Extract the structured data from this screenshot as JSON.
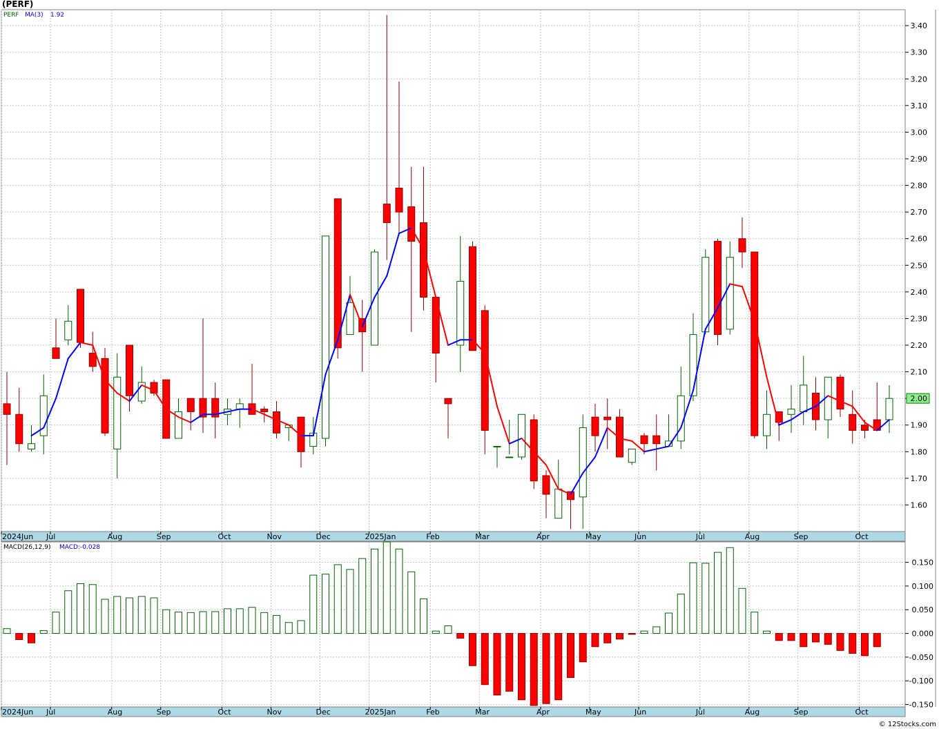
{
  "title": "(PERF)",
  "credit": "© 12Stocks.com",
  "colors": {
    "up": "#006400",
    "down": "#ff0000",
    "down_outline": "#8b0000",
    "ma": "#0000ff",
    "ma_down": "#ff0000",
    "grid": "#c0c0c0",
    "axis_band": "#add8e6",
    "last_price_box": "#90ee90"
  },
  "chart_data": [
    {
      "type": "candlestick",
      "legend": {
        "symbol": "PERF",
        "ma_label": "MA(3)",
        "ma_value": "1.92"
      },
      "last_price_label": "2.00",
      "y_ticks": [
        "1.60",
        "1.70",
        "1.80",
        "1.90",
        "2.00",
        "2.10",
        "2.20",
        "2.30",
        "2.40",
        "2.50",
        "2.60",
        "2.70",
        "2.80",
        "2.90",
        "3.00",
        "3.10",
        "3.20",
        "3.30",
        "3.40"
      ],
      "ylim": [
        1.5,
        3.46
      ],
      "x_labels": [
        "2024Jun",
        "Jul",
        "Aug",
        "Sep",
        "Oct",
        "Nov",
        "Dec",
        "2025Jan",
        "Feb",
        "Mar",
        "Apr",
        "May",
        "Jun",
        "Jul",
        "Aug",
        "Sep",
        "Oct"
      ],
      "x_label_weeks": [
        0,
        4,
        9,
        13,
        18,
        22,
        26,
        30,
        35,
        39,
        44,
        48,
        52,
        57,
        61,
        65,
        70
      ],
      "weeks": 72,
      "candles": [
        [
          1.98,
          2.1,
          1.75,
          1.94
        ],
        [
          1.94,
          2.04,
          1.8,
          1.83
        ],
        [
          1.81,
          1.9,
          1.8,
          1.83
        ],
        [
          1.86,
          2.09,
          1.79,
          2.01
        ],
        [
          2.19,
          2.3,
          2.15,
          2.15
        ],
        [
          2.22,
          2.35,
          2.2,
          2.29
        ],
        [
          2.41,
          2.38,
          2.19,
          2.21
        ],
        [
          2.17,
          2.25,
          2.1,
          2.12
        ],
        [
          2.15,
          2.19,
          1.86,
          1.87
        ],
        [
          1.81,
          2.17,
          1.7,
          2.08
        ],
        [
          2.2,
          2.1,
          1.95,
          2.01
        ],
        [
          1.99,
          2.12,
          1.98,
          2.06
        ],
        [
          2.06,
          2.07,
          2.01,
          2.02
        ],
        [
          2.07,
          2.0,
          1.85,
          1.85
        ],
        [
          1.85,
          2.0,
          1.85,
          1.95
        ],
        [
          2.0,
          2.0,
          1.88,
          1.95
        ],
        [
          2.0,
          2.3,
          1.87,
          1.93
        ],
        [
          2.0,
          2.06,
          1.85,
          1.93
        ],
        [
          1.94,
          2.0,
          1.9,
          1.96
        ],
        [
          1.96,
          2.0,
          1.89,
          1.98
        ],
        [
          1.98,
          2.13,
          1.95,
          1.94
        ],
        [
          1.96,
          1.97,
          1.91,
          1.95
        ],
        [
          1.95,
          1.99,
          1.85,
          1.87
        ],
        [
          1.89,
          1.89,
          1.84,
          1.9
        ],
        [
          1.93,
          1.93,
          1.74,
          1.8
        ],
        [
          1.82,
          1.93,
          1.79,
          1.87
        ],
        [
          1.85,
          2.61,
          1.82,
          2.61
        ],
        [
          2.75,
          2.75,
          2.15,
          2.19
        ],
        [
          2.24,
          2.46,
          2.24,
          2.36
        ],
        [
          2.3,
          2.37,
          2.1,
          2.25
        ],
        [
          2.2,
          2.56,
          2.2,
          2.55
        ],
        [
          2.73,
          3.44,
          2.52,
          2.66
        ],
        [
          2.79,
          3.19,
          2.62,
          2.7
        ],
        [
          2.72,
          2.87,
          2.25,
          2.59
        ],
        [
          2.66,
          2.87,
          2.33,
          2.38
        ],
        [
          2.38,
          2.38,
          2.06,
          2.17
        ],
        [
          2.0,
          2.0,
          1.85,
          1.98
        ],
        [
          2.2,
          2.61,
          2.1,
          2.44
        ],
        [
          2.57,
          2.59,
          2.19,
          2.18
        ],
        [
          2.33,
          2.35,
          1.79,
          1.88
        ],
        [
          1.82,
          1.82,
          1.74,
          1.82
        ],
        [
          1.78,
          1.92,
          1.79,
          1.78
        ],
        [
          1.78,
          1.94,
          1.77,
          1.94
        ],
        [
          1.92,
          1.94,
          1.66,
          1.69
        ],
        [
          1.71,
          1.73,
          1.55,
          1.64
        ],
        [
          1.55,
          1.77,
          1.55,
          1.66
        ],
        [
          1.65,
          1.65,
          1.51,
          1.62
        ],
        [
          1.63,
          1.94,
          1.51,
          1.89
        ],
        [
          1.93,
          1.98,
          1.8,
          1.86
        ],
        [
          1.93,
          2.0,
          1.81,
          1.92
        ],
        [
          1.93,
          1.96,
          1.78,
          1.78
        ],
        [
          1.76,
          1.8,
          1.75,
          1.81
        ],
        [
          1.86,
          1.87,
          1.79,
          1.83
        ],
        [
          1.86,
          1.94,
          1.73,
          1.83
        ],
        [
          1.82,
          1.94,
          1.83,
          1.84
        ],
        [
          1.84,
          2.12,
          1.81,
          2.01
        ],
        [
          2.01,
          2.32,
          1.99,
          2.24
        ],
        [
          2.25,
          2.56,
          2.24,
          2.53
        ],
        [
          2.59,
          2.6,
          2.2,
          2.24
        ],
        [
          2.26,
          2.59,
          2.24,
          2.53
        ],
        [
          2.6,
          2.68,
          2.49,
          2.55
        ],
        [
          2.55,
          2.55,
          1.85,
          1.86
        ],
        [
          1.86,
          2.03,
          1.81,
          1.94
        ],
        [
          1.95,
          1.95,
          1.84,
          1.91
        ],
        [
          1.94,
          2.05,
          1.87,
          1.96
        ],
        [
          1.95,
          2.16,
          1.9,
          2.05
        ],
        [
          2.02,
          2.08,
          1.88,
          1.92
        ],
        [
          1.92,
          2.08,
          1.85,
          2.08
        ],
        [
          2.08,
          2.09,
          1.93,
          1.96
        ],
        [
          1.94,
          2.03,
          1.83,
          1.88
        ],
        [
          1.9,
          1.92,
          1.85,
          1.88
        ],
        [
          1.92,
          2.06,
          1.88,
          1.88
        ],
        [
          1.92,
          2.05,
          1.87,
          2.0
        ]
      ],
      "ma3": [
        null,
        null,
        1.86,
        1.89,
        2.0,
        2.15,
        2.21,
        2.2,
        2.07,
        2.02,
        1.99,
        2.05,
        2.03,
        1.96,
        1.93,
        1.91,
        1.94,
        1.94,
        1.95,
        1.96,
        1.96,
        1.94,
        1.92,
        1.9,
        1.86,
        1.86,
        2.09,
        2.22,
        2.39,
        2.27,
        2.38,
        2.46,
        2.62,
        2.64,
        2.56,
        2.38,
        2.2,
        2.22,
        2.22,
        2.17,
        1.97,
        1.83,
        1.85,
        1.8,
        1.75,
        1.66,
        1.64,
        1.72,
        1.78,
        1.89,
        1.85,
        1.84,
        1.8,
        1.81,
        1.82,
        1.89,
        2.03,
        2.26,
        2.34,
        2.43,
        2.42,
        2.29,
        2.08,
        1.9,
        1.92,
        1.95,
        1.97,
        2.01,
        1.99,
        1.97,
        1.91,
        1.88,
        1.92
      ]
    },
    {
      "type": "bar",
      "legend": {
        "label": "MACD(26,12,9)",
        "value_label": "MACD:-0.028"
      },
      "y_ticks": [
        "0.150",
        "0.100",
        "0.050",
        "0.000",
        "-0.050",
        "-0.100",
        "-0.150"
      ],
      "ylim": [
        -0.155,
        0.193
      ],
      "values": [
        0.01,
        -0.013,
        -0.02,
        0.006,
        0.045,
        0.09,
        0.105,
        0.103,
        0.072,
        0.078,
        0.075,
        0.078,
        0.075,
        0.05,
        0.045,
        0.044,
        0.046,
        0.046,
        0.052,
        0.052,
        0.055,
        0.044,
        0.038,
        0.023,
        0.027,
        0.123,
        0.125,
        0.145,
        0.135,
        0.158,
        0.178,
        0.193,
        0.178,
        0.13,
        0.073,
        0.005,
        0.016,
        -0.01,
        -0.068,
        -0.108,
        -0.13,
        -0.122,
        -0.14,
        -0.152,
        -0.148,
        -0.14,
        -0.093,
        -0.06,
        -0.028,
        -0.02,
        -0.012,
        -0.002,
        0.005,
        0.014,
        0.043,
        0.083,
        0.149,
        0.148,
        0.171,
        0.181,
        0.095,
        0.045,
        0.005,
        -0.015,
        -0.015,
        -0.028,
        -0.018,
        -0.023,
        -0.036,
        -0.042,
        -0.047,
        -0.028
      ]
    }
  ]
}
